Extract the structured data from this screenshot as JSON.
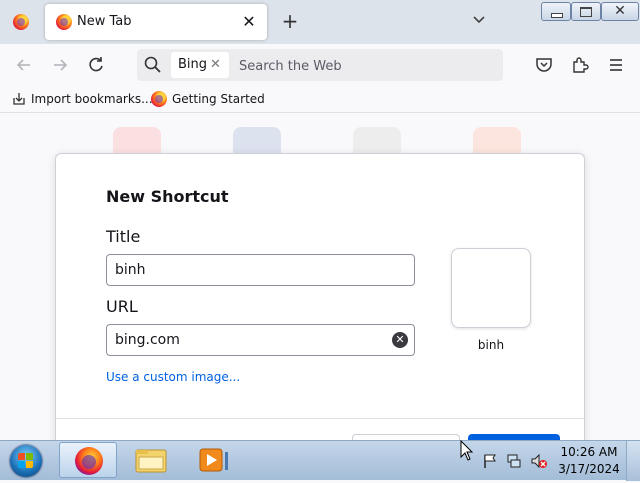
{
  "browser": {
    "tab": {
      "title": "New Tab"
    },
    "new_tab_symbol": "+",
    "close_symbol": "✕"
  },
  "navbar": {
    "search_engine": "Bing",
    "search_engine_remove": "✕",
    "search_placeholder": "Search the Web"
  },
  "bookmarks": [
    {
      "label": "Import bookmarks..."
    },
    {
      "label": "Getting Started"
    }
  ],
  "dialog": {
    "title": "New Shortcut",
    "title_label": "Title",
    "title_value": "binh",
    "url_label": "URL",
    "url_value": "bing.com",
    "custom_image_link": "Use a custom image...",
    "preview_label": "binh"
  },
  "taskbar": {
    "time": "10:26 AM",
    "date": "3/17/2024"
  },
  "colors": {
    "accent": "#0061e0",
    "link": "#0061e0",
    "taskbar": "#b3c9e0"
  },
  "icons": [
    "firefox-logo-icon",
    "close-icon",
    "plus-icon",
    "chevron-down-icon",
    "back-arrow-icon",
    "forward-arrow-icon",
    "reload-icon",
    "search-icon",
    "pocket-icon",
    "extensions-icon",
    "hamburger-menu-icon",
    "import-icon",
    "windows-start-icon",
    "explorer-icon",
    "media-player-icon",
    "flag-icon",
    "network-icon",
    "volume-muted-icon",
    "mouse-cursor-icon"
  ]
}
